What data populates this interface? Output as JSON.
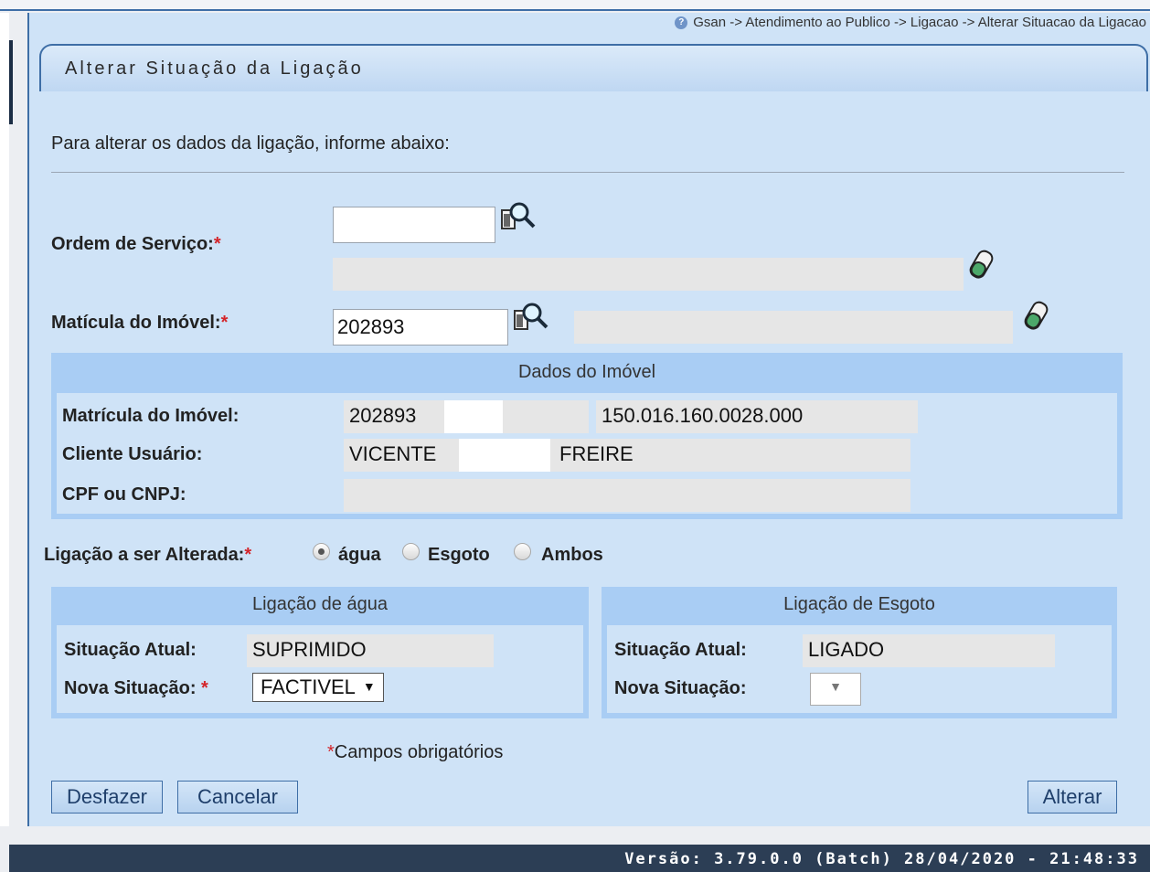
{
  "breadcrumb": "Gsan -> Atendimento ao Publico -> Ligacao -> Alterar Situacao da Ligacao",
  "page_title": "Alterar Situação da Ligação",
  "intro": "Para alterar os dados da ligação, informe abaixo:",
  "form": {
    "ordem_servico_label": "Ordem de Serviço:",
    "ordem_servico_value": "",
    "matricula_label": "Matícula do Imóvel:",
    "matricula_value": "202893",
    "required_mark": "*"
  },
  "dados_imovel": {
    "legend": "Dados do Imóvel",
    "matricula_label": "Matrícula do Imóvel:",
    "matricula_value": "202893",
    "inscricao_value": "150.016.160.0028.000",
    "cliente_label": "Cliente Usuário:",
    "cliente_first": "VICENTE",
    "cliente_last": "FREIRE",
    "cpf_label": "CPF ou CNPJ:",
    "cpf_value": ""
  },
  "ligacao_alterada": {
    "label": "Ligação a ser Alterada:",
    "options": [
      "água",
      "Esgoto",
      "Ambos"
    ],
    "selected": "água"
  },
  "ligacao_agua": {
    "legend": "Ligação de água",
    "situacao_atual_label": "Situação Atual:",
    "situacao_atual_value": "SUPRIMIDO",
    "nova_situacao_label": "Nova Situação:",
    "nova_situacao_value": "FACTIVEL"
  },
  "ligacao_esgoto": {
    "legend": "Ligação de Esgoto",
    "situacao_atual_label": "Situação Atual:",
    "situacao_atual_value": "LIGADO",
    "nova_situacao_label": "Nova Situação:",
    "nova_situacao_value": ""
  },
  "required_note": "Campos obrigatórios",
  "buttons": {
    "desfazer": "Desfazer",
    "cancelar": "Cancelar",
    "alterar": "Alterar"
  },
  "footer_version": "Versão: 3.79.0.0 (Batch) 28/04/2020 - 21:48:33",
  "icons": {
    "help": "help-icon",
    "search": "search-icon",
    "erase": "eraser-icon",
    "dropdown": "chevron-down-icon"
  }
}
